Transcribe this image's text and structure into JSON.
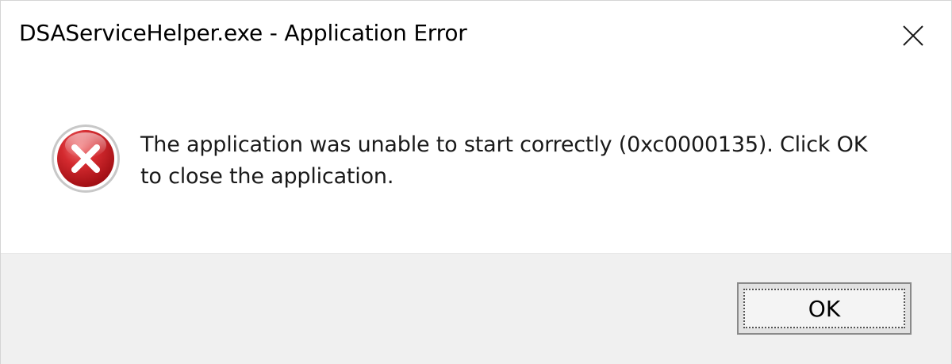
{
  "window": {
    "title": "DSAServiceHelper.exe - Application Error",
    "close_icon": "close-icon"
  },
  "content": {
    "icon": "error-icon",
    "icon_color": "#c4161c",
    "message_line1": "The application was unable to start correctly (0xc0000135). Click OK",
    "message_line2": "to close the application."
  },
  "footer": {
    "ok_label": "OK",
    "background": "#f0f0f0"
  }
}
